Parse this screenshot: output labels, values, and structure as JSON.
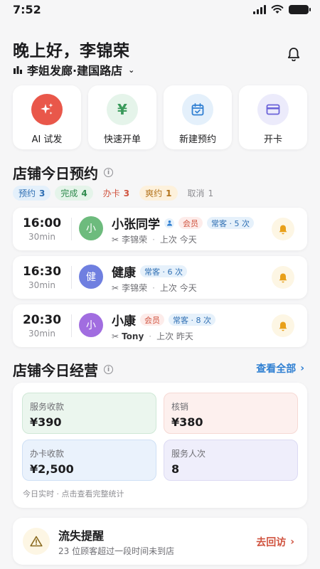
{
  "status_bar": {
    "time": "7:52"
  },
  "header": {
    "greeting": "晚上好，李锦荣",
    "store_name": "李姐发廊·建国路店"
  },
  "quick_actions": [
    {
      "label": "AI 试发",
      "icon": "sparkle-icon",
      "color": "#e9574a"
    },
    {
      "label": "快速开单",
      "icon": "yen-icon",
      "color": "#3a9a5b"
    },
    {
      "label": "新建预约",
      "icon": "calendar-icon",
      "color": "#2f7fd2"
    },
    {
      "label": "开卡",
      "icon": "card-icon",
      "color": "#6b63d9"
    }
  ],
  "appointments_section": {
    "title": "店铺今日预约",
    "chips": [
      {
        "label": "预约",
        "count": "3"
      },
      {
        "label": "完成",
        "count": "4"
      },
      {
        "label": "办卡",
        "count": "3"
      },
      {
        "label": "爽约",
        "count": "1"
      },
      {
        "label": "取消",
        "count": "1"
      }
    ],
    "items": [
      {
        "time": "16:00",
        "duration": "30min",
        "avatar": "小",
        "avatar_color": "#6dbb7d",
        "name": "小张同学",
        "member_tag": "会员",
        "regular_tag": "常客 · 5 次",
        "stylist": "李锦荣",
        "last_visit": "上次 今天"
      },
      {
        "time": "16:30",
        "duration": "30min",
        "avatar": "健",
        "avatar_color": "#6f7fe0",
        "name": "健康",
        "regular_tag": "常客 · 6 次",
        "stylist": "李锦荣",
        "last_visit": "上次 今天"
      },
      {
        "time": "20:30",
        "duration": "30min",
        "avatar": "小",
        "avatar_color": "#a16de0",
        "name": "小康",
        "member_tag": "会员",
        "regular_tag": "常客 · 8 次",
        "stylist": "Tony",
        "last_visit": "上次 昨天"
      }
    ]
  },
  "business_section": {
    "title": "店铺今日经营",
    "view_all": "查看全部",
    "stats": [
      {
        "label": "服务收款",
        "value": "¥390"
      },
      {
        "label": "核销",
        "value": "¥380"
      },
      {
        "label": "办卡收款",
        "value": "¥2,500"
      },
      {
        "label": "服务人次",
        "value": "8"
      }
    ],
    "note": "今日实时 · 点击查看完整统计"
  },
  "churn_alert": {
    "title": "流失提醒",
    "description": "23 位顾客超过一段时间未到店",
    "action": "去回访"
  }
}
